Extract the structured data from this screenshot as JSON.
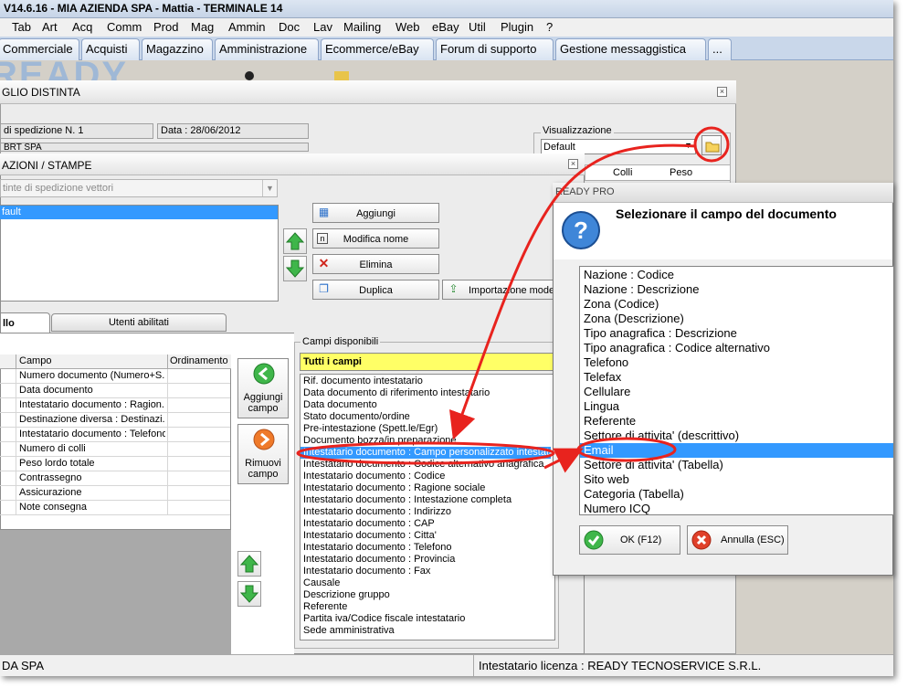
{
  "window": {
    "title": "V14.6.16 - MIA AZIENDA SPA - Mattia - TERMINALE 14"
  },
  "menu": [
    "Tab",
    "Art",
    "Acq",
    "Comm",
    "Prod",
    "Mag",
    "Ammin",
    "Doc",
    "Lav",
    "Mailing",
    "Web",
    "eBay",
    "Util",
    "Plugin",
    "?"
  ],
  "top_tabs": [
    "Commerciale",
    "Acquisti",
    "Magazzino",
    "Amministrazione",
    "Ecommerce/eBay",
    "Forum di supporto",
    "Gestione messaggistica",
    "..."
  ],
  "background_logo": "READY",
  "bordereau": {
    "title": "GLIO DISTINTA",
    "spedizione": "di spedizione N. 1",
    "data": "Data : 28/06/2012",
    "corriere": "BRT SPA",
    "visualizzazione_label": "Visualizzazione",
    "visualizzazione_value": "Default",
    "col_colli": "Colli",
    "col_peso": "Peso"
  },
  "config": {
    "title": "AZIONI / STAMPE",
    "print_select": "tinte di spedizione vettori",
    "layout_item": "fault",
    "buttons": {
      "add": "Aggiungi",
      "rename": "Modifica nome",
      "delete": "Elimina",
      "duplicate": "Duplica",
      "import": "Importazione model"
    },
    "tabs": [
      "llo",
      "Utenti abilitati"
    ],
    "grid_headers": [
      "Campo",
      "Ordinamento"
    ],
    "grid_rows": [
      "Numero documento (Numero+S...",
      "Data documento",
      "Intestatario documento : Ragion...",
      "Destinazione diversa : Destinazi...",
      "Intestatario documento : Telefono",
      "Numero di colli",
      "Peso lordo totale",
      "Contrassegno",
      "Assicurazione",
      "Note consegna"
    ],
    "add_field": "Aggiungi campo",
    "remove_field": "Rimuovi campo",
    "available_label": "Campi disponibili",
    "available_filter": "Tutti i campi",
    "available_fields": [
      "Rif. documento intestatario",
      "Data documento di riferimento intestatario",
      "Data documento",
      "Stato documento/ordine",
      "Pre-intestazione (Spett.le/Egr)",
      "Documento bozza/in preparazione",
      "Intestatario documento : Campo personalizzato intestatario",
      "Intestatario documento : Codice alternativo anagrafica",
      "Intestatario documento : Codice",
      "Intestatario documento : Ragione sociale",
      "Intestatario documento : Intestazione completa",
      "Intestatario documento : Indirizzo",
      "Intestatario documento : CAP",
      "Intestatario documento : Citta'",
      "Intestatario documento : Telefono",
      "Intestatario documento : Provincia",
      "Intestatario documento : Fax",
      "Causale",
      "Descrizione gruppo",
      "Referente",
      "Partita iva/Codice fiscale intestatario",
      "Sede amministrativa"
    ],
    "selected_available_index": 6
  },
  "dialog": {
    "title": "READY PRO",
    "heading": "Selezionare il campo del documento",
    "items": [
      "Nazione : Codice",
      "Nazione : Descrizione",
      "Zona (Codice)",
      "Zona (Descrizione)",
      "Tipo anagrafica : Descrizione",
      "Tipo anagrafica : Codice alternativo",
      "Telefono",
      "Telefax",
      "Cellulare",
      "Lingua",
      "Referente",
      "Settore di attivita' (descrittivo)",
      "Email",
      "Settore di attivita' (Tabella)",
      "Sito web",
      "Categoria (Tabella)",
      "Numero ICQ"
    ],
    "selected_index": 12,
    "ok": "OK (F12)",
    "cancel": "Annulla (ESC)"
  },
  "status": {
    "company": "DA SPA",
    "license": "Intestatario licenza : READY TECNOSERVICE S.R.L."
  },
  "colors": {
    "selection": "#3399ff",
    "highlight_yellow": "#ffff66",
    "annotation_red": "#e8231e"
  }
}
